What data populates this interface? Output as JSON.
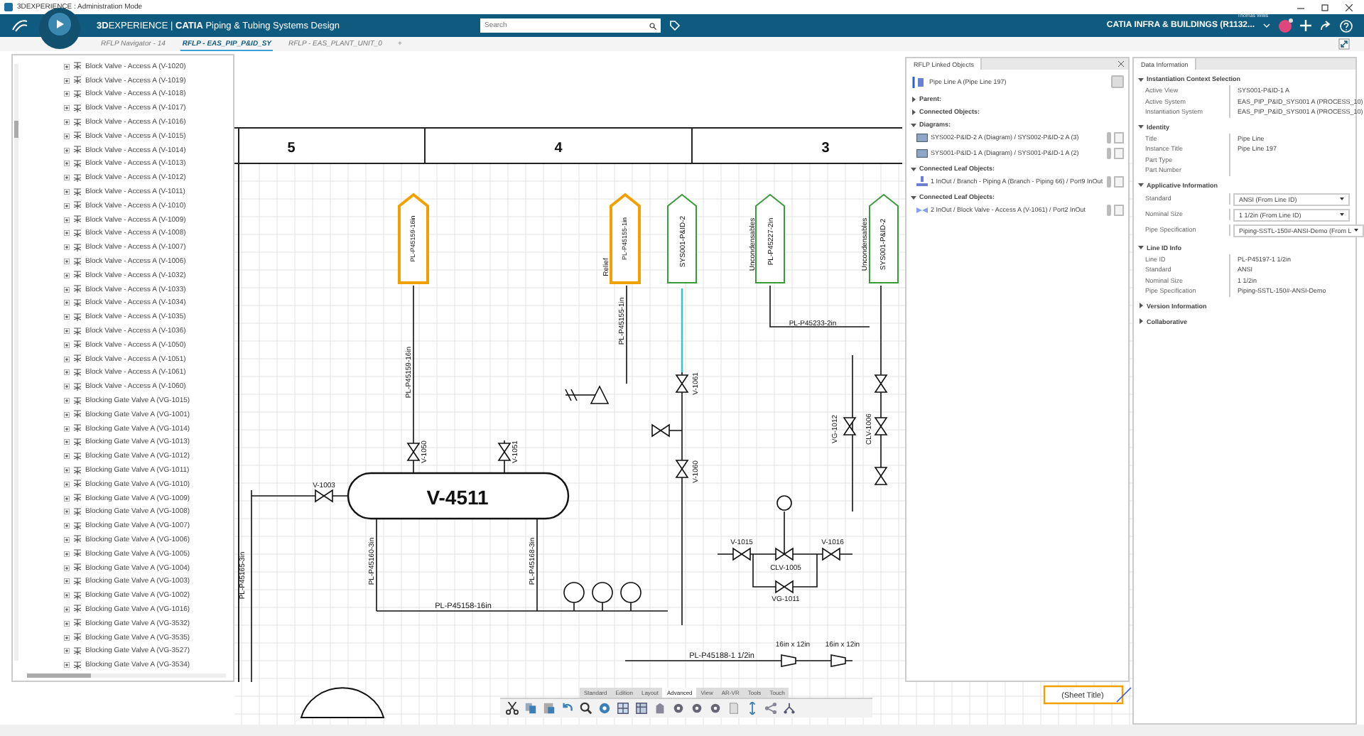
{
  "window": {
    "title": "3DEXPERIENCE : Administration Mode"
  },
  "header": {
    "brand": "**3D**EXPERIENCE | **CATIA** Piping & Tubing Systems Design",
    "search": {
      "placeholder": "Search"
    },
    "user": "Thomas Willis",
    "context": "CATIA INFRA & BUILDINGS (R1132..."
  },
  "tabs": [
    {
      "label": "RFLP Navigator - 14",
      "selected": false
    },
    {
      "label": "RFLP - EAS_PIP_P&ID_SY",
      "selected": true
    },
    {
      "label": "RFLP - EAS_PLANT_UNIT_0",
      "selected": false
    }
  ],
  "add_tab": "+",
  "tree": {
    "items": [
      {
        "label": "Block Valve - Access A (V-1020)",
        "expanded": false
      },
      {
        "label": "Block Valve - Access A (V-1019)",
        "expanded": false
      },
      {
        "label": "Block Valve - Access A (V-1018)",
        "expanded": false
      },
      {
        "label": "Block Valve - Access A (V-1017)",
        "expanded": false
      },
      {
        "label": "Block Valve - Access A (V-1016)",
        "expanded": false
      },
      {
        "label": "Block Valve - Access A (V-1015)",
        "expanded": false
      },
      {
        "label": "Block Valve - Access A (V-1014)",
        "expanded": false
      },
      {
        "label": "Block Valve - Access A (V-1013)",
        "expanded": false
      },
      {
        "label": "Block Valve - Access A (V-1012)",
        "expanded": false
      },
      {
        "label": "Block Valve - Access A (V-1011)",
        "expanded": false
      },
      {
        "label": "Block Valve - Access A (V-1010)",
        "expanded": false
      },
      {
        "label": "Block Valve - Access A (V-1009)",
        "expanded": false
      },
      {
        "label": "Block Valve - Access A (V-1008)",
        "expanded": false
      },
      {
        "label": "Block Valve - Access A (V-1007)",
        "expanded": false
      },
      {
        "label": "Block Valve - Access A (V-1006)",
        "expanded": false
      },
      {
        "label": "Block Valve - Access A (V-1032)",
        "expanded": false
      },
      {
        "label": "Block Valve - Access A (V-1033)",
        "expanded": false
      },
      {
        "label": "Block Valve - Access A (V-1034)",
        "expanded": false
      },
      {
        "label": "Block Valve - Access A (V-1035)",
        "expanded": false
      },
      {
        "label": "Block Valve - Access A (V-1036)",
        "expanded": false
      },
      {
        "label": "Block Valve - Access A (V-1050)",
        "expanded": false
      },
      {
        "label": "Block Valve - Access A (V-1051)",
        "expanded": false
      },
      {
        "label": "Block Valve - Access A (V-1061)",
        "expanded": false
      },
      {
        "label": "Block Valve - Access A (V-1060)",
        "expanded": false
      },
      {
        "label": "Blocking Gate Valve A (VG-1015)",
        "expanded": false
      },
      {
        "label": "Blocking Gate Valve A (VG-1001)",
        "expanded": false
      },
      {
        "label": "Blocking Gate Valve A (VG-1014)",
        "expanded": false
      },
      {
        "label": "Blocking Gate Valve A (VG-1013)",
        "expanded": false
      },
      {
        "label": "Blocking Gate Valve A (VG-1012)",
        "expanded": false
      },
      {
        "label": "Blocking Gate Valve A (VG-1011)",
        "expanded": false
      },
      {
        "label": "Blocking Gate Valve A (VG-1010)",
        "expanded": false
      },
      {
        "label": "Blocking Gate Valve A (VG-1009)",
        "expanded": false
      },
      {
        "label": "Blocking Gate Valve A (VG-1008)",
        "expanded": false
      },
      {
        "label": "Blocking Gate Valve A (VG-1007)",
        "expanded": false
      },
      {
        "label": "Blocking Gate Valve A (VG-1006)",
        "expanded": false
      },
      {
        "label": "Blocking Gate Valve A (VG-1005)",
        "expanded": false
      },
      {
        "label": "Blocking Gate Valve A (VG-1004)",
        "expanded": false
      },
      {
        "label": "Blocking Gate Valve A (VG-1003)",
        "expanded": false
      },
      {
        "label": "Blocking Gate Valve A (VG-1002)",
        "expanded": false
      },
      {
        "label": "Blocking Gate Valve A (VG-1016)",
        "expanded": false
      },
      {
        "label": "Blocking Gate Valve A (VG-3532)",
        "expanded": false
      },
      {
        "label": "Blocking Gate Valve A (VG-3535)",
        "expanded": false
      },
      {
        "label": "Blocking Gate Valve A (VG-3527)",
        "expanded": false
      },
      {
        "label": "Blocking Gate Valve A (VG-3534)",
        "expanded": false
      }
    ]
  },
  "drawing": {
    "labels": [
      "5",
      "4",
      "3",
      "V-4511",
      "V-1003",
      "V-1050",
      "V-1051",
      "PL-P45158-16in",
      "PL-P45233-2in",
      "V-1061",
      "V-1060",
      "V-1015",
      "V-1016",
      "CLV-1005",
      "VG-1011",
      "PL-P45188-1 1/2in",
      "16in x 12in",
      "16in x 12in",
      "(Sheet Title)",
      "PL-P45159-16in",
      "PL-P45165-3in",
      "PL-P45160-3in",
      "PL-P45168-3in",
      "Relief",
      "PL-P45155-1in",
      "Uncondensables",
      "Uncondensables",
      "PL-P45227-2in",
      "SYS001-P&ID-2",
      "SYS001-P&ID-2",
      "VG-1012",
      "CLV-1006",
      "PL-P45159-16in",
      "PL-P45155-1in"
    ]
  },
  "linked_panel": {
    "title": "RFLP Linked Objects",
    "object": "Pipe Line A (Pipe Line 197)",
    "sections": [
      {
        "title": "Parent:",
        "expanded": false
      },
      {
        "title": "Connected Objects:",
        "expanded": false
      },
      {
        "title": "Diagrams:",
        "expanded": true,
        "items": [
          {
            "kind": "diagram",
            "label": "SYS002-P&ID-2 A (Diagram) / SYS002-P&ID-2 A (3)"
          },
          {
            "kind": "diagram",
            "label": "SYS001-P&ID-1 A (Diagram) / SYS001-P&ID-1 A (2)"
          }
        ]
      },
      {
        "title": "Connected Leaf Objects:",
        "expanded": true,
        "items": [
          {
            "kind": "branch",
            "label": "1 InOut / Branch - Piping A (Branch - Piping 66) / Port9 InOut"
          }
        ]
      },
      {
        "title": "Connected Leaf Objects:",
        "expanded": true,
        "items": [
          {
            "kind": "valve",
            "label": "2 InOut / Block Valve - Access A (V-1061) / Port2 InOut"
          }
        ]
      }
    ]
  },
  "data_panel": {
    "title": "Data Information",
    "sections": [
      {
        "title": "Instantiation Context Selection",
        "expanded": true,
        "rows": [
          {
            "label": "Active View",
            "value": "SYS001-P&ID-1 A",
            "kind": "text"
          },
          {
            "label": "Active System",
            "value": "EAS_PIP_P&ID_SYS001 A (PROCESS_10)",
            "kind": "text"
          },
          {
            "label": "Instantiation System",
            "value": "EAS_PIP_P&ID_SYS001 A (PROCESS_10)",
            "kind": "text"
          }
        ]
      },
      {
        "title": "Identity",
        "expanded": true,
        "rows": [
          {
            "label": "Title",
            "value": "Pipe Line",
            "kind": "text"
          },
          {
            "label": "Instance Title",
            "value": "Pipe Line 197",
            "kind": "text"
          },
          {
            "label": "Part Type",
            "kind": "text"
          },
          {
            "label": "Part Number",
            "kind": "text"
          }
        ]
      },
      {
        "title": "Applicative Information",
        "expanded": true,
        "rows": [
          {
            "label": "Standard",
            "value": "ANSI  (From Line ID)",
            "kind": "dropdown"
          },
          {
            "label": "Nominal Size",
            "value": "1 1/2in  (From Line ID)",
            "kind": "dropdown"
          },
          {
            "label": "Pipe Specification",
            "value": "Piping-SSTL-150#-ANSI-Demo  (From L",
            "kind": "dropdown"
          }
        ]
      },
      {
        "title": "Line ID Info",
        "expanded": true,
        "rows": [
          {
            "label": "Line ID",
            "value": "PL-P45197-1 1/2in",
            "kind": "text"
          },
          {
            "label": "Standard",
            "value": "ANSI",
            "kind": "text"
          },
          {
            "label": "Nominal Size",
            "value": "1 1/2in",
            "kind": "text"
          },
          {
            "label": "Pipe Specification",
            "value": "Piping-SSTL-150#-ANSI-Demo",
            "kind": "text"
          }
        ]
      },
      {
        "title": "Version Information",
        "expanded": false
      },
      {
        "title": "Collaborative",
        "expanded": false
      }
    ]
  },
  "toolbar": {
    "tabs": [
      {
        "label": "Standard",
        "selected": false
      },
      {
        "label": "Edition",
        "selected": false
      },
      {
        "label": "Layout",
        "selected": false
      },
      {
        "label": "Advanced",
        "selected": true
      },
      {
        "label": "View",
        "selected": false
      },
      {
        "label": "AR-VR",
        "selected": false
      },
      {
        "label": "Tools",
        "selected": false
      },
      {
        "label": "Touch",
        "selected": false
      }
    ]
  }
}
